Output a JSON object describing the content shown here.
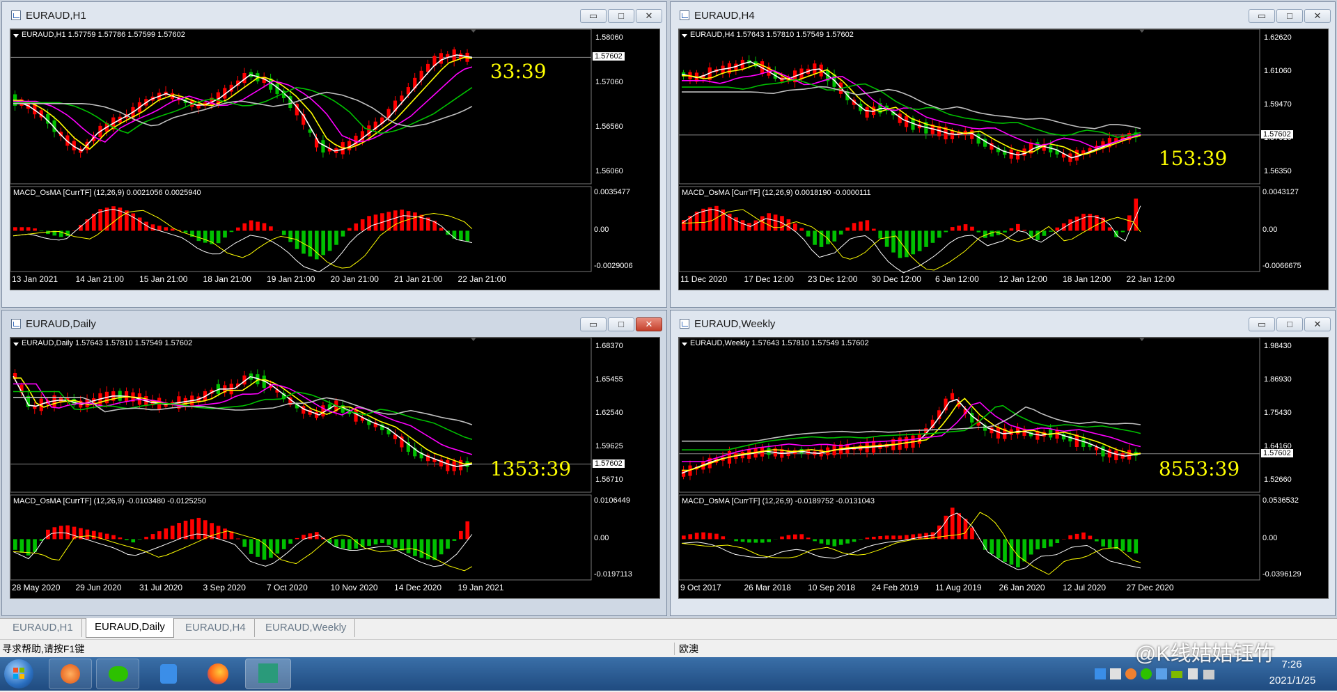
{
  "windows": [
    {
      "title": "EURAUD,H1",
      "timer": "33:39",
      "price_info": "EURAUD,H1  1.57759 1.57786 1.57599 1.57602",
      "current_price": "1.57602",
      "price_ticks": [
        "1.58060",
        "1.57060",
        "1.56560",
        "1.56060"
      ],
      "macd_info": "MACD_OsMA [CurrTF] (12,26,9) 0.0021056 0.0025940",
      "macd_ticks": [
        "0.0035477",
        "0.00",
        "-0.0029006"
      ],
      "date_labels": [
        "13 Jan 2021",
        "14 Jan 21:00",
        "15 Jan 21:00",
        "18 Jan 21:00",
        "19 Jan 21:00",
        "20 Jan 21:00",
        "21 Jan 21:00",
        "22 Jan 21:00"
      ],
      "close_button_red": false
    },
    {
      "title": "EURAUD,H4",
      "timer": "153:39",
      "price_info": "EURAUD,H4  1.57643 1.57810 1.57549 1.57602",
      "current_price": "1.57602",
      "price_ticks": [
        "1.62620",
        "1.61060",
        "1.59470",
        "1.57910",
        "1.56350"
      ],
      "macd_info": "MACD_OsMA [CurrTF] (12,26,9) 0.0018190 -0.0000111",
      "macd_ticks": [
        "0.0043127",
        "0.00",
        "-0.0066675"
      ],
      "date_labels": [
        "11 Dec 2020",
        "17 Dec 12:00",
        "23 Dec 12:00",
        "30 Dec 12:00",
        "6 Jan 12:00",
        "12 Jan 12:00",
        "18 Jan 12:00",
        "22 Jan 12:00"
      ],
      "close_button_red": false
    },
    {
      "title": "EURAUD,Daily",
      "timer": "1353:39",
      "price_info": "EURAUD,Daily  1.57643 1.57810 1.57549 1.57602",
      "current_price": "1.57602",
      "price_ticks": [
        "1.68370",
        "1.65455",
        "1.62540",
        "1.59625",
        "1.56710"
      ],
      "macd_info": "MACD_OsMA [CurrTF] (12,26,9) -0.0103480 -0.0125250",
      "macd_ticks": [
        "0.0106449",
        "0.00",
        "-0.0197113"
      ],
      "date_labels": [
        "28 May 2020",
        "29 Jun 2020",
        "31 Jul 2020",
        "3 Sep 2020",
        "7 Oct 2020",
        "10 Nov 2020",
        "14 Dec 2020",
        "19 Jan 2021"
      ],
      "close_button_red": true
    },
    {
      "title": "EURAUD,Weekly",
      "timer": "8553:39",
      "price_info": "EURAUD,Weekly  1.57643 1.57810 1.57549 1.57602",
      "current_price": "1.57602",
      "price_ticks": [
        "1.98430",
        "1.86930",
        "1.75430",
        "1.64160",
        "1.52660"
      ],
      "macd_info": "MACD_OsMA [CurrTF] (12,26,9) -0.0189752 -0.0131043",
      "macd_ticks": [
        "0.0536532",
        "0.00",
        "-0.0396129"
      ],
      "date_labels": [
        "9 Oct 2017",
        "26 Mar 2018",
        "10 Sep 2018",
        "24 Feb 2019",
        "11 Aug 2019",
        "26 Jan 2020",
        "12 Jul 2020",
        "27 Dec 2020"
      ],
      "close_button_red": false
    }
  ],
  "window_buttons": {
    "minimize": "▭",
    "maximize": "□",
    "close": "✕"
  },
  "tabs": [
    "EURAUD,H1",
    "EURAUD,Daily",
    "EURAUD,H4",
    "EURAUD,Weekly"
  ],
  "active_tab": "EURAUD,Daily",
  "status": {
    "help": "寻求帮助,请按F1键",
    "profile": "欧澳"
  },
  "taskbar": {
    "time": "7:26",
    "date": "2021/1/25",
    "watermark": "@K线姑姑钰竹"
  },
  "colors": {
    "bull": "#ff0000",
    "bear": "#00c000",
    "ma_fast": "#ffffff",
    "ma_yellow": "#ffff00",
    "ma_magenta": "#ff00ff",
    "ma_green": "#00c000",
    "ma_silver": "#c0c0c0",
    "timer": "#ffff00"
  }
}
